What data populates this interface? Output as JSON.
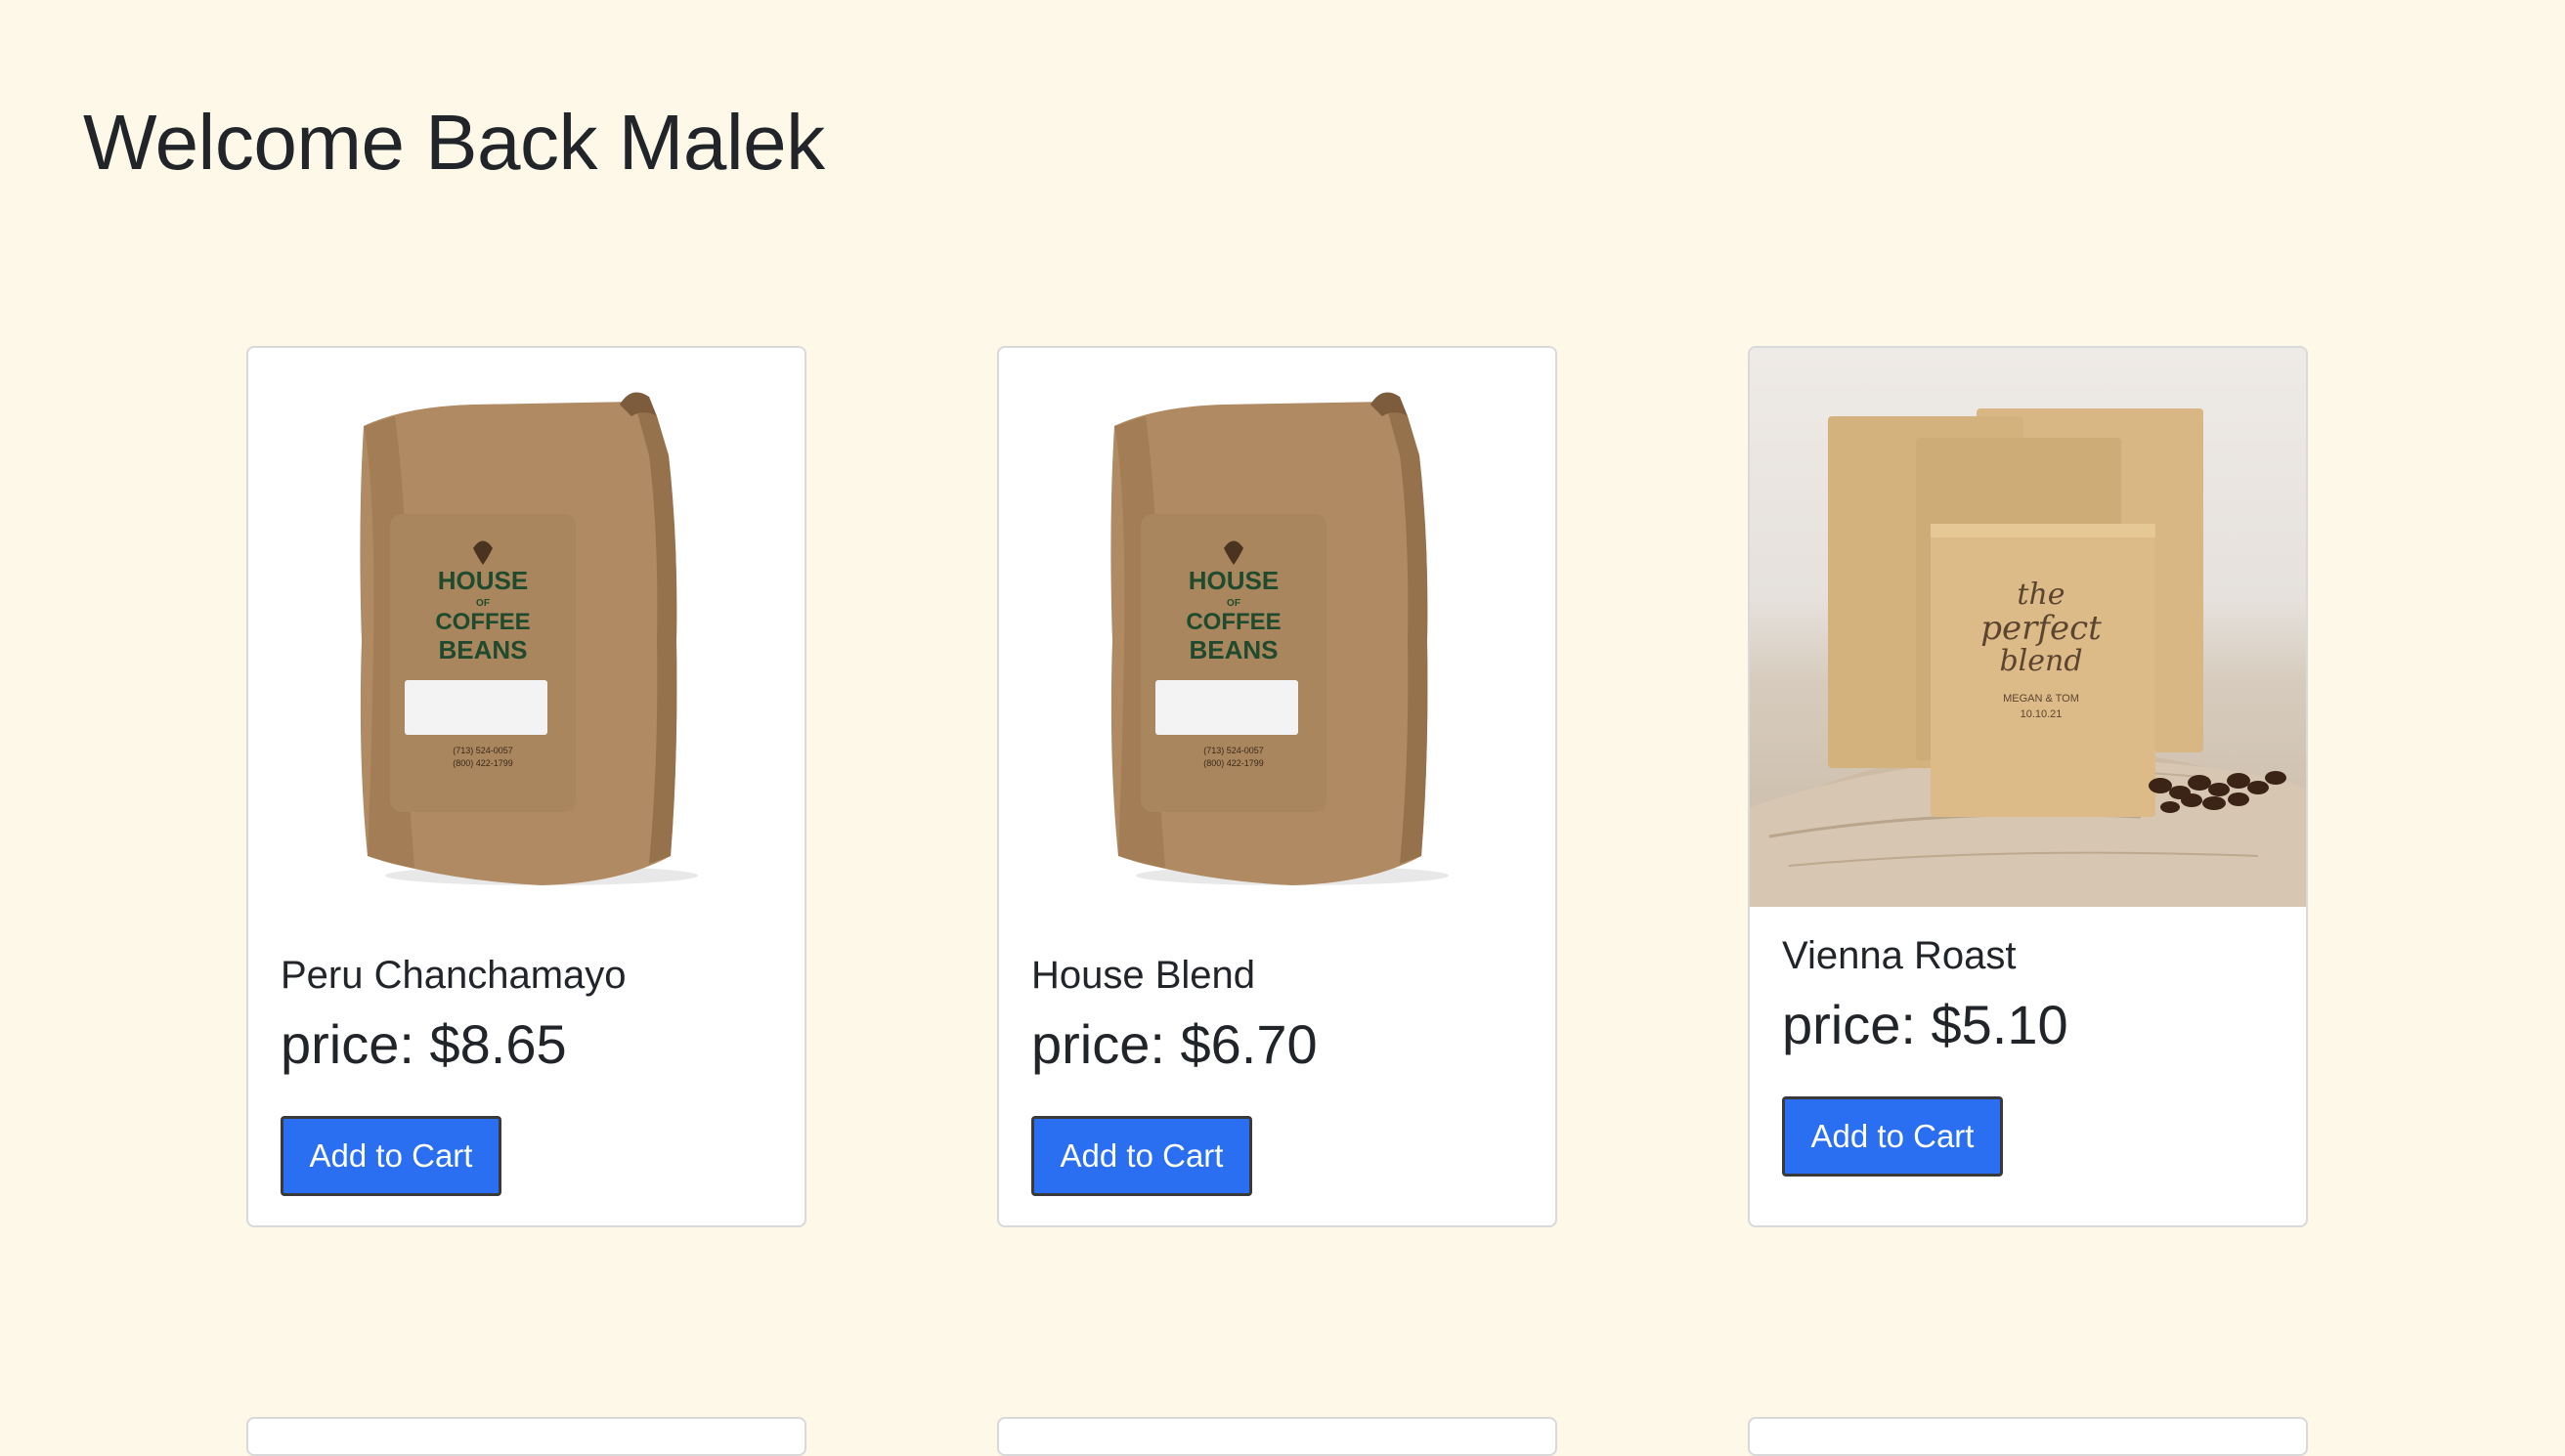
{
  "page": {
    "heading": "Welcome Back Malek",
    "background": "#fdf8e8"
  },
  "products": [
    {
      "name": "Peru Chanchamayo",
      "price": "price: $8.65",
      "button": "Add to Cart",
      "image": "coffee-bag-house-of-coffee-beans"
    },
    {
      "name": "House Blend",
      "price": "price: $6.70",
      "button": "Add to Cart",
      "image": "coffee-bag-house-of-coffee-beans"
    },
    {
      "name": "Vienna Roast",
      "price": "price: $5.10",
      "button": "Add to Cart",
      "image": "the-perfect-blend-pouches-photo"
    }
  ],
  "bag_label": {
    "line1": "HOUSE",
    "line2": "OF",
    "line3": "COFFEE",
    "line4": "BEANS",
    "phone1": "(713) 524-0057",
    "phone2": "(800) 422-1799"
  },
  "pouch_label": {
    "line1": "the",
    "line2": "perfect",
    "line3": "blend",
    "line4": "MEGAN & TOM",
    "line5": "10.10.21"
  },
  "colors": {
    "button": "#2a6ff2",
    "card_border": "#d9d9d9",
    "text": "#212529"
  }
}
